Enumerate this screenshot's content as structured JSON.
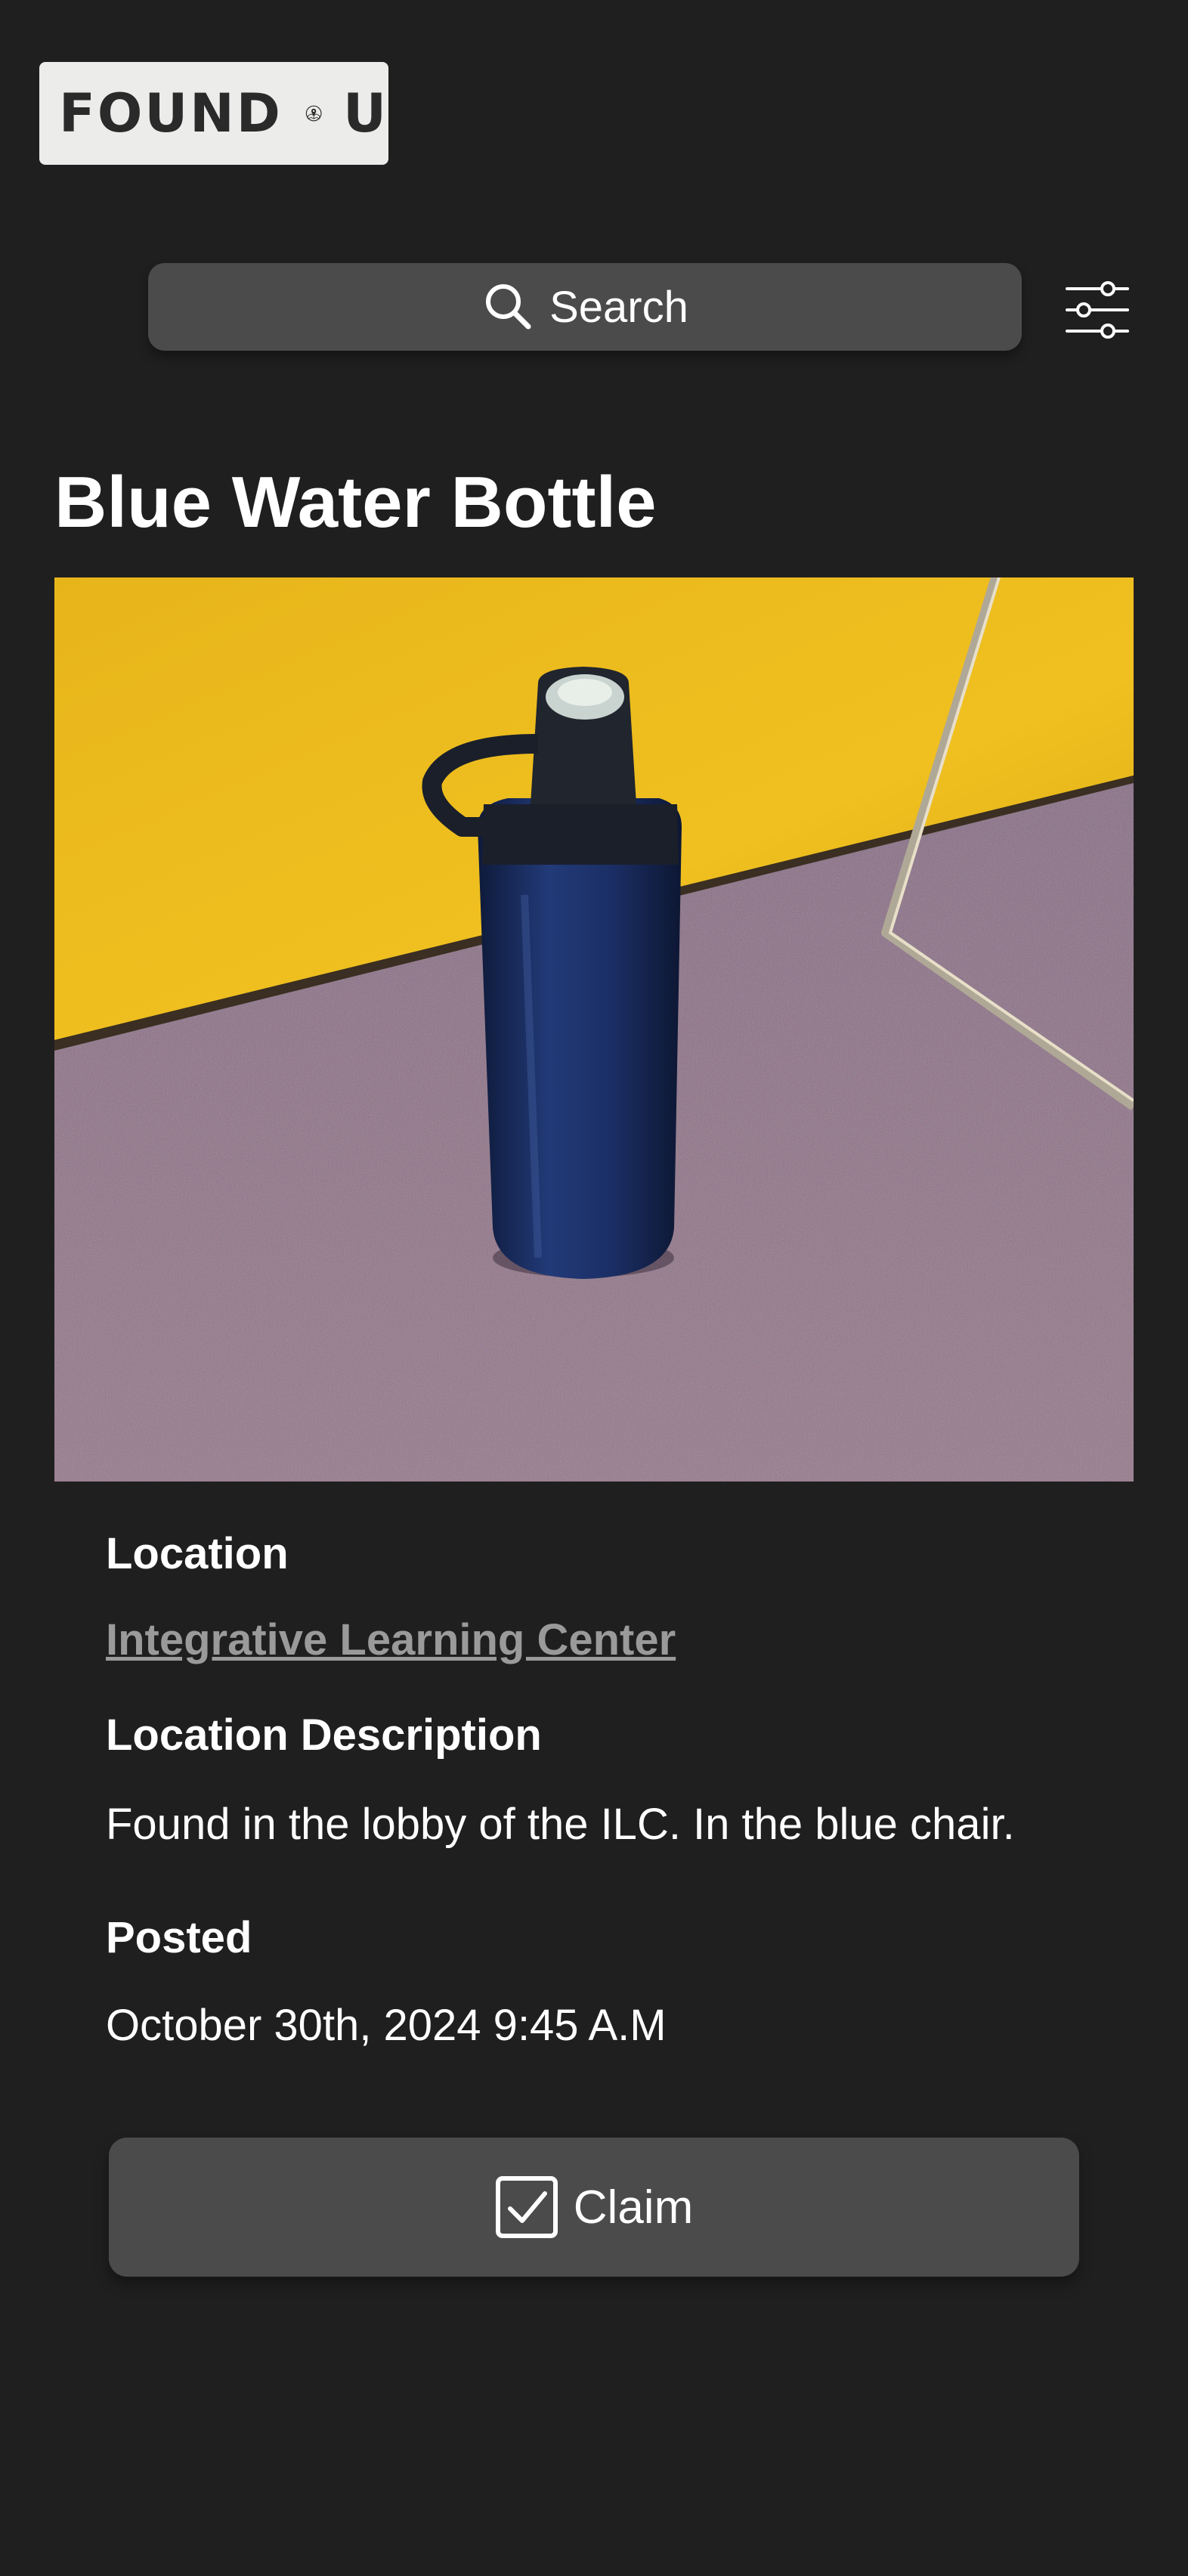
{
  "header": {
    "logo_word_1": "FOUND",
    "logo_word_2": "U",
    "logo_icon": "map-pin-book-icon"
  },
  "search": {
    "placeholder": "Search",
    "icon": "search-icon"
  },
  "filter": {
    "icon": "filter-sliders-icon"
  },
  "item": {
    "title": "Blue Water Bottle",
    "photo_subject": "blue water bottle on carpet",
    "location_label": "Location",
    "location_value": "Integrative Learning Center",
    "location_description_label": "Location Description",
    "location_description": "Found in the lobby of the ILC. In the blue chair.",
    "posted_label": "Posted",
    "posted_value": "October 30th, 2024 9:45 A.M"
  },
  "actions": {
    "claim_label": "Claim",
    "claim_icon": "checkbox-checked-icon"
  },
  "colors": {
    "background": "#201f20",
    "surface": "#4b4b4b",
    "logo_background": "#ececeb",
    "link": "#9a9a9a",
    "text": "#ffffff"
  }
}
